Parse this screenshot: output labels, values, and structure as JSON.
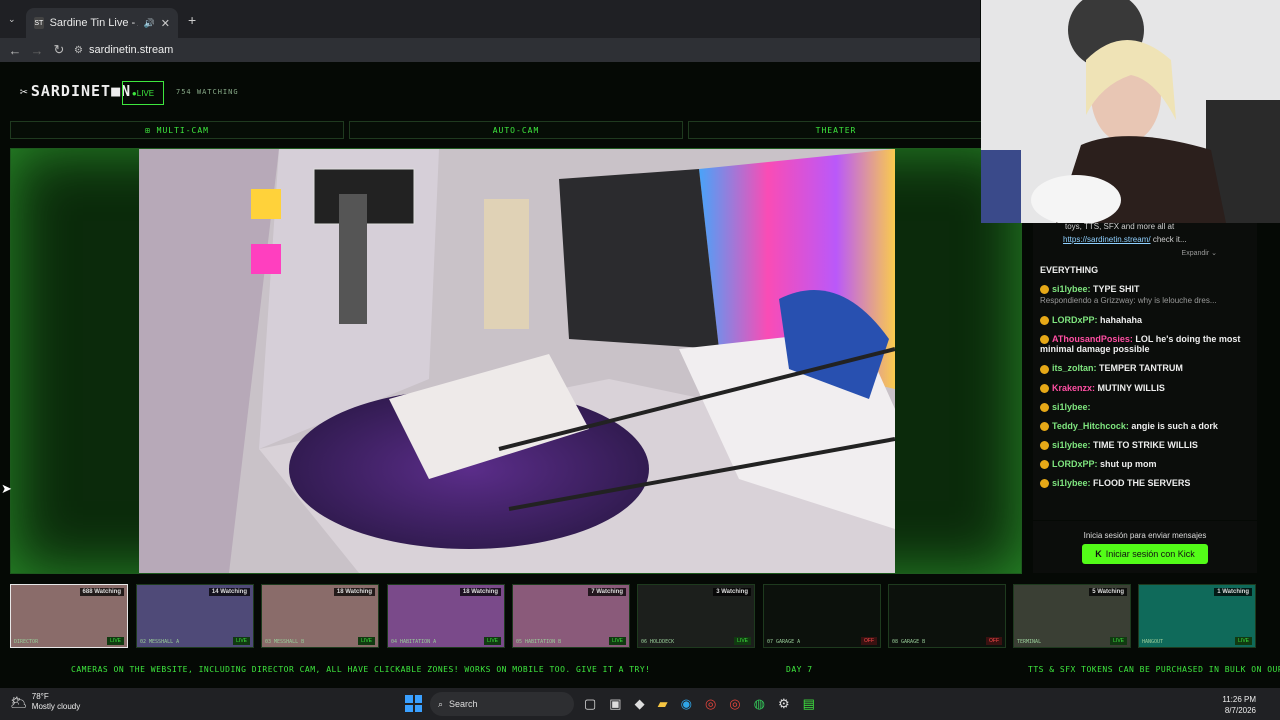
{
  "browser": {
    "tab_title": "Sardine Tin Live - All Rooms",
    "url": "sardinetin.stream"
  },
  "site": {
    "logo": "SARDINET■N",
    "live_badge": "●LIVE",
    "watching": "754 WATCHING",
    "tabs": [
      "⊞ MULTI-CAM",
      "AUTO-CAM",
      "THEATER"
    ]
  },
  "chat": {
    "pinned_text": "toys, TTS, SFX and more all at",
    "pinned_link": "https://sardinetin.stream/",
    "pinned_suffix": " check it...",
    "expand": "Expandir",
    "messages": [
      {
        "user": "",
        "text": "EVERYTHING",
        "color": "#eeeeee"
      },
      {
        "user": "si1lybee:",
        "text": "TYPE SHIT",
        "color": "#7fe57f"
      },
      {
        "reply": "Respondiendo a Grizzway: why is lelouche dres..."
      },
      {
        "user": "LORDxPP:",
        "text": "hahahaha",
        "color": "#7fe57f"
      },
      {
        "user": "AThousandPosies:",
        "text": "LOL he's doing the most minimal damage possible",
        "color": "#ff4fa3"
      },
      {
        "user": "its_zoltan:",
        "text": "TEMPER TANTRUM",
        "color": "#7fe57f"
      },
      {
        "user": "Krakenzx:",
        "text": "MUTINY WILLIS",
        "color": "#ff4fa3"
      },
      {
        "user": "si1lybee:",
        "text": "",
        "color": "#7fe57f"
      },
      {
        "user": "Teddy_Hitchcock:",
        "text": "angie is such a dork",
        "color": "#7fe57f"
      },
      {
        "user": "si1lybee:",
        "text": "TIME TO STRIKE WILLIS",
        "color": "#7fe57f"
      },
      {
        "user": "LORDxPP:",
        "text": "shut up mom",
        "color": "#7fe57f"
      },
      {
        "user": "si1lybee:",
        "text": "FLOOD THE SERVERS",
        "color": "#7fe57f"
      }
    ],
    "login_prompt": "Inicia sesión para enviar mensajes",
    "login_button": "Iniciar sesión con Kick"
  },
  "thumbs": [
    {
      "watch": "688 Watching",
      "name": "DIRECTOR",
      "status": "LIVE"
    },
    {
      "watch": "14 Watching",
      "name": "02 MESSHALL A",
      "status": "LIVE"
    },
    {
      "watch": "18 Watching",
      "name": "03 MESSHALL B",
      "status": "LIVE"
    },
    {
      "watch": "18 Watching",
      "name": "04 HABITATION A",
      "status": "LIVE"
    },
    {
      "watch": "7 Watching",
      "name": "05 HABITATION B",
      "status": "LIVE"
    },
    {
      "watch": "3 Watching",
      "name": "06 HOLDDECK",
      "status": "LIVE"
    },
    {
      "watch": "",
      "name": "07 GARAGE A",
      "status": "OFF"
    },
    {
      "watch": "",
      "name": "08 GARAGE B",
      "status": "OFF"
    },
    {
      "watch": "5 Watching",
      "name": "TERMINAL",
      "status": "LIVE"
    },
    {
      "watch": "1 Watching",
      "name": "HANGOUT",
      "status": "LIVE"
    }
  ],
  "ticker": {
    "left": "CAMERAS ON THE WEBSITE, INCLUDING DIRECTOR CAM, ALL HAVE CLICKABLE ZONES! WORKS ON MOBILE TOO. GIVE IT A TRY!",
    "mid": "DAY 7",
    "right": "TTS & SFX TOKENS CAN BE PURCHASED IN BULK ON OUR S"
  },
  "taskbar": {
    "temp": "78°F",
    "weather": "Mostly cloudy",
    "search": "Search",
    "time": "11:26 PM",
    "date": "8/7/2026"
  }
}
